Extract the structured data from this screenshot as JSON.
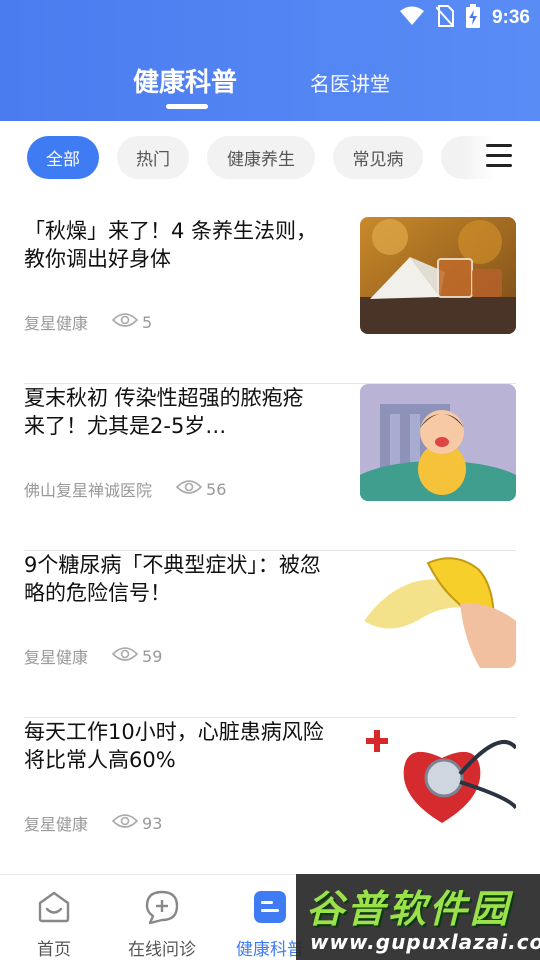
{
  "status_bar": {
    "time": "9:36",
    "icons": [
      "wifi-icon",
      "no-sim-icon",
      "battery-charging-icon"
    ]
  },
  "header": {
    "tabs": [
      {
        "label": "健康科普",
        "active": true
      },
      {
        "label": "名医讲堂",
        "active": false
      }
    ]
  },
  "filters": {
    "chips": [
      {
        "label": "全部",
        "active": true
      },
      {
        "label": "热门",
        "active": false
      },
      {
        "label": "健康养生",
        "active": false
      },
      {
        "label": "常见病",
        "active": false
      }
    ],
    "menu_icon": "menu-icon"
  },
  "articles": [
    {
      "title": "「秋燥」来了！4 条养生法则，教你调出好身体",
      "source": "复星健康",
      "views": "5",
      "image": "book-and-tea-thumbnail"
    },
    {
      "title": "夏末秋初 传染性超强的脓疱疮来了！尤其是2-5岁…",
      "source": "佛山复星禅诚医院",
      "views": "56",
      "image": "crying-child-thumbnail"
    },
    {
      "title": "9个糖尿病「不典型症状」：被忽略的危险信号！",
      "source": "复星健康",
      "views": "59",
      "image": "banana-thumbnail"
    },
    {
      "title": "每天工作10小时，心脏患病风险将比常人高60%",
      "source": "复星健康",
      "views": "93",
      "image": "stethoscope-heart-thumbnail"
    }
  ],
  "bottom_nav": {
    "items": [
      {
        "label": "首页",
        "icon": "home-smile-icon",
        "active": false
      },
      {
        "label": "在线问诊",
        "icon": "chat-plus-icon",
        "active": false
      },
      {
        "label": "健康科普",
        "icon": "article-icon",
        "active": true
      }
    ]
  },
  "watermark": {
    "title": "谷普软件园",
    "url": "www.gupuxlazai.com"
  },
  "colors": {
    "primary": "#3f7cf3",
    "header_gradient_start": "#4a7cf0",
    "header_gradient_end": "#5a8cf6",
    "meta_gray": "#999999"
  }
}
